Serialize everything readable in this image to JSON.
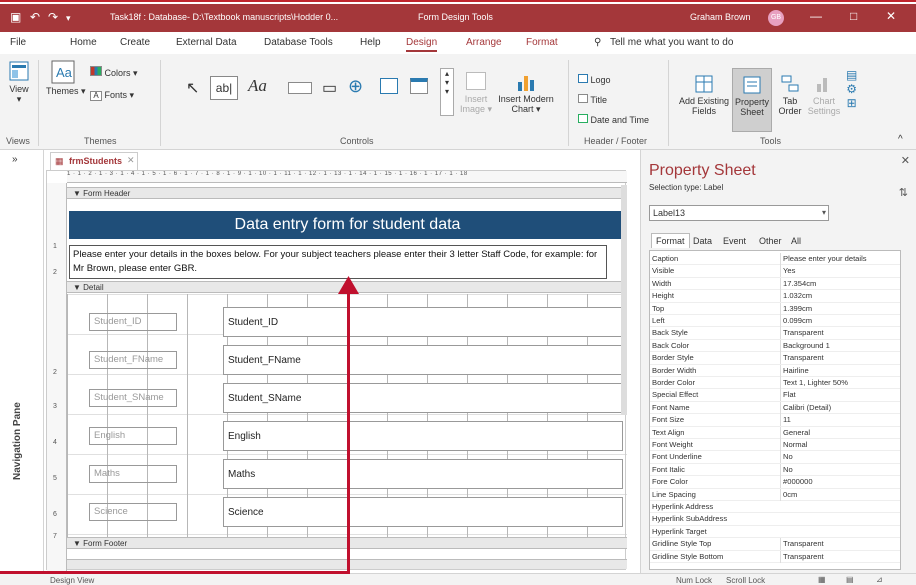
{
  "titlebar": {
    "title": "Task18f : Database- D:\\Textbook manuscripts\\Hodder 0...",
    "context": "Form Design Tools",
    "user": "Graham Brown",
    "initials": "GB"
  },
  "tabs": [
    "File",
    "Home",
    "Create",
    "External Data",
    "Database Tools",
    "Help",
    "Design",
    "Arrange",
    "Format"
  ],
  "tell_me": "Tell me what you want to do",
  "ribbon": {
    "views": {
      "view": "View",
      "group": "Views"
    },
    "themes": {
      "themes": "Themes",
      "colors": "Colors",
      "fonts": "Fonts",
      "group": "Themes"
    },
    "controls": {
      "ab": "ab|",
      "aa": "Aa",
      "insert_image": "Insert Image",
      "insert_chart": "Insert Modern Chart",
      "group": "Controls"
    },
    "header_footer": {
      "logo": "Logo",
      "title": "Title",
      "date_time": "Date and Time",
      "group": "Header / Footer"
    },
    "tools": {
      "add_fields": "Add Existing Fields",
      "property_sheet": "Property Sheet",
      "tab_order": "Tab Order",
      "chart_settings": "Chart Settings",
      "group": "Tools"
    }
  },
  "nav_pane_label": "Navigation Pane",
  "doc_tab": "frmStudents",
  "design": {
    "ruler": "1 · 1 · 2 · 1 · 3 · 1 · 4 · 1 · 5 · 1 · 6 · 1 · 7 · 1 · 8 · 1 · 9 · 1 · 10 · 1 · 11 · 1 · 12 · 1 · 13 · 1 · 14 · 1 · 15 · 1 · 16 · 1 · 17 · 1 · 18",
    "form_header": "Form Header",
    "title": "Data entry form for student data",
    "instructions": "Please enter your details in the boxes below. For your subject teachers please enter their 3 letter Staff Code, for example: for Mr Brown, please enter GBR.",
    "detail": "Detail",
    "form_footer": "Form Footer",
    "fields": [
      {
        "label": "Student_ID",
        "box": "Student_ID"
      },
      {
        "label": "Student_FName",
        "box": "Student_FName"
      },
      {
        "label": "Student_SName",
        "box": "Student_SName"
      },
      {
        "label": "English",
        "box": "English"
      },
      {
        "label": "Maths",
        "box": "Maths"
      },
      {
        "label": "Science",
        "box": "Science"
      }
    ]
  },
  "property_sheet": {
    "title": "Property Sheet",
    "selection_type": "Selection type: Label",
    "selected": "Label13",
    "tabs": [
      "Format",
      "Data",
      "Event",
      "Other",
      "All"
    ],
    "rows": [
      {
        "k": "Caption",
        "v": "Please enter your details"
      },
      {
        "k": "Visible",
        "v": "Yes"
      },
      {
        "k": "Width",
        "v": "17.354cm"
      },
      {
        "k": "Height",
        "v": "1.032cm"
      },
      {
        "k": "Top",
        "v": "1.399cm"
      },
      {
        "k": "Left",
        "v": "0.099cm"
      },
      {
        "k": "Back Style",
        "v": "Transparent"
      },
      {
        "k": "Back Color",
        "v": "Background 1"
      },
      {
        "k": "Border Style",
        "v": "Transparent"
      },
      {
        "k": "Border Width",
        "v": "Hairline"
      },
      {
        "k": "Border Color",
        "v": "Text 1, Lighter 50%"
      },
      {
        "k": "Special Effect",
        "v": "Flat"
      },
      {
        "k": "Font Name",
        "v": "Calibri (Detail)"
      },
      {
        "k": "Font Size",
        "v": "11"
      },
      {
        "k": "Text Align",
        "v": "General"
      },
      {
        "k": "Font Weight",
        "v": "Normal"
      },
      {
        "k": "Font Underline",
        "v": "No"
      },
      {
        "k": "Font Italic",
        "v": "No"
      },
      {
        "k": "Fore Color",
        "v": "#000000"
      },
      {
        "k": "Line Spacing",
        "v": "0cm"
      },
      {
        "k": "Hyperlink Address",
        "v": ""
      },
      {
        "k": "Hyperlink SubAddress",
        "v": ""
      },
      {
        "k": "Hyperlink Target",
        "v": ""
      },
      {
        "k": "Gridline Style Top",
        "v": "Transparent"
      },
      {
        "k": "Gridline Style Bottom",
        "v": "Transparent"
      }
    ]
  },
  "statusbar": {
    "left": "Design View",
    "num_lock": "Num Lock",
    "scroll_lock": "Scroll Lock"
  },
  "colors": {
    "accent": "#a4373a",
    "header_fill": "#1f4e79",
    "arrow": "#c0102e"
  }
}
